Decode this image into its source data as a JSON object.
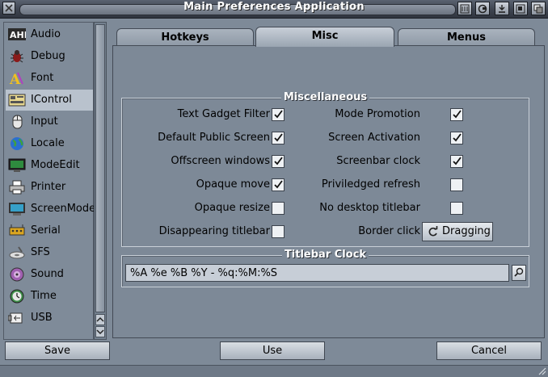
{
  "window": {
    "title": "Main Preferences Application"
  },
  "sidebar": {
    "items": [
      {
        "label": "Audio",
        "icon": "ahi-icon"
      },
      {
        "label": "Debug",
        "icon": "bug-icon"
      },
      {
        "label": "Font",
        "icon": "font-icon"
      },
      {
        "label": "IControl",
        "icon": "icontrol-icon",
        "selected": true
      },
      {
        "label": "Input",
        "icon": "mouse-icon"
      },
      {
        "label": "Locale",
        "icon": "globe-icon"
      },
      {
        "label": "ModeEdit",
        "icon": "monitor-icon"
      },
      {
        "label": "Printer",
        "icon": "printer-icon"
      },
      {
        "label": "ScreenMode",
        "icon": "screen-icon"
      },
      {
        "label": "Serial",
        "icon": "serial-icon"
      },
      {
        "label": "SFS",
        "icon": "disk-icon"
      },
      {
        "label": "Sound",
        "icon": "speaker-icon"
      },
      {
        "label": "Time",
        "icon": "clock-icon"
      },
      {
        "label": "USB",
        "icon": "usb-icon"
      }
    ]
  },
  "tabs": [
    {
      "label": "Hotkeys",
      "active": false
    },
    {
      "label": "Misc",
      "active": true
    },
    {
      "label": "Menus",
      "active": false
    }
  ],
  "misc": {
    "group_title": "Miscellaneous",
    "left_options": [
      {
        "label": "Text Gadget Filter",
        "checked": true
      },
      {
        "label": "Default Public Screen",
        "checked": true
      },
      {
        "label": "Offscreen windows",
        "checked": true
      },
      {
        "label": "Opaque move",
        "checked": true
      },
      {
        "label": "Opaque resize",
        "checked": false
      },
      {
        "label": "Disappearing titlebar",
        "checked": false
      }
    ],
    "right_options": [
      {
        "label": "Mode Promotion",
        "checked": true
      },
      {
        "label": "Screen Activation",
        "checked": true
      },
      {
        "label": "Screenbar clock",
        "checked": true
      },
      {
        "label": "Priviledged refresh",
        "checked": false
      },
      {
        "label": "No desktop titlebar",
        "checked": false
      }
    ],
    "border_click": {
      "label": "Border click",
      "value": "Dragging"
    }
  },
  "titlebar_clock": {
    "group_title": "Titlebar Clock",
    "format": "%A %e %B %Y - %q:%M:%S"
  },
  "buttons": {
    "save": "Save",
    "use": "Use",
    "cancel": "Cancel"
  }
}
